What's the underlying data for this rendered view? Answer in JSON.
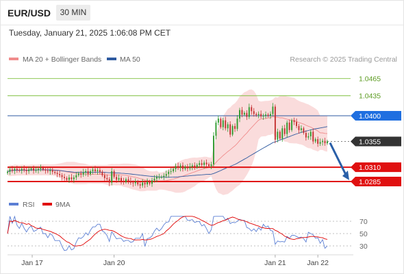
{
  "header": {
    "symbol": "EUR/USD",
    "timeframe": "30 MIN",
    "timestamp": "Tuesday, January 21, 2025 1:06:08 PM CET"
  },
  "legend": {
    "ma20": "MA 20 + Bollinger Bands",
    "ma50": "MA 50",
    "source": "Research © 2025 Trading Central",
    "rsi": "RSI",
    "ma9": "9MA"
  },
  "colors": {
    "ma20": "#f08c8c",
    "ma50": "#2e5aa0",
    "rsi": "#5b7fd4",
    "ma9": "#e00000",
    "candle_up": "#2f9a2f",
    "candle_down": "#c43030",
    "target_line": "#2a5fa8",
    "support": "#e01010",
    "resistance_green": "#7fbf3f",
    "current_price": "#333333"
  },
  "chart_data": [
    {
      "type": "candlestick",
      "title": "",
      "x_ticks": [
        "Jan 17",
        "Jan 20",
        "Jan 21",
        "Jan 22"
      ],
      "ylim": [
        1.0255,
        1.0485
      ],
      "levels": [
        {
          "value": 1.0465,
          "label": "1.0465",
          "kind": "target"
        },
        {
          "value": 1.0435,
          "label": "1.0435",
          "kind": "target"
        },
        {
          "value": 1.04,
          "label": "1.0400",
          "kind": "pivot"
        },
        {
          "value": 1.0355,
          "label": "1.0355",
          "kind": "last"
        },
        {
          "value": 1.031,
          "label": "1.0310",
          "kind": "support"
        },
        {
          "value": 1.0285,
          "label": "1.0285",
          "kind": "support"
        }
      ],
      "close_series": [
        1.0302,
        1.0306,
        1.0304,
        1.0307,
        1.0305,
        1.0304,
        1.0307,
        1.0305,
        1.0303,
        1.0306,
        1.0308,
        1.0304,
        1.0305,
        1.0307,
        1.0309,
        1.0306,
        1.0304,
        1.0303,
        1.0305,
        1.0302,
        1.03,
        1.0298,
        1.0296,
        1.0293,
        1.0291,
        1.0288,
        1.0292,
        1.0289,
        1.0292,
        1.0296,
        1.0299,
        1.0297,
        1.0301,
        1.0303,
        1.0298,
        1.0303,
        1.0306,
        1.0303,
        1.0305,
        1.0302,
        1.0296,
        1.0291,
        1.0289,
        1.0283,
        1.0303,
        1.0293,
        1.0288,
        1.0291,
        1.0286,
        1.0284,
        1.0289,
        1.0286,
        1.0283,
        1.0282,
        1.0285,
        1.028,
        1.0278,
        1.0283,
        1.028,
        1.0285,
        1.0281,
        1.0287,
        1.029,
        1.0293,
        1.0293,
        1.0293,
        1.0295,
        1.0298,
        1.0302,
        1.0303,
        1.0307,
        1.0312,
        1.0309,
        1.0313,
        1.0307,
        1.0311,
        1.0308,
        1.0311,
        1.0313,
        1.031,
        1.0314,
        1.0317,
        1.0314,
        1.0318,
        1.0315,
        1.0312,
        1.0315,
        1.0365,
        1.0388,
        1.0395,
        1.038,
        1.0392,
        1.0378,
        1.0385,
        1.0367,
        1.0382,
        1.0377,
        1.0395,
        1.041,
        1.0402,
        1.0405,
        1.0398,
        1.0415,
        1.0408,
        1.0403,
        1.0401,
        1.0403,
        1.0399,
        1.04,
        1.0402,
        1.04,
        1.0403,
        1.0416,
        1.0358,
        1.0372,
        1.036,
        1.0378,
        1.0368,
        1.0388,
        1.0375,
        1.0392,
        1.0389,
        1.0382,
        1.0375,
        1.0378,
        1.037,
        1.0362,
        1.0364,
        1.0372,
        1.0355,
        1.0359,
        1.0351,
        1.0354,
        1.0356,
        1.0352,
        1.0355
      ],
      "rsi_ticks": [
        30,
        50,
        70
      ]
    }
  ]
}
